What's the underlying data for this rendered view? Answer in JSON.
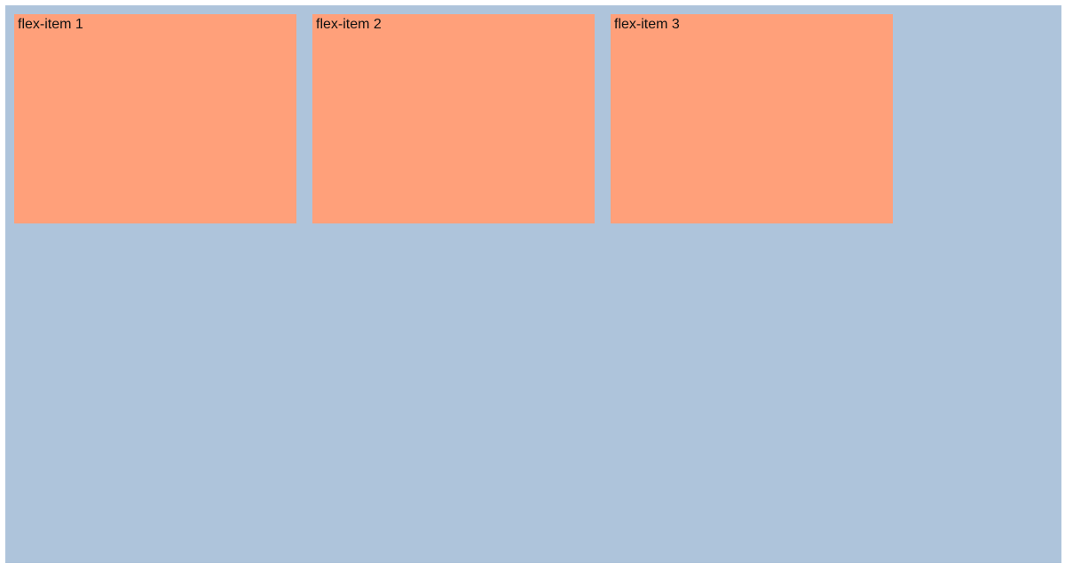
{
  "items": [
    {
      "label": "flex-item 1"
    },
    {
      "label": "flex-item 2"
    },
    {
      "label": "flex-item 3"
    }
  ],
  "colors": {
    "containerBg": "#aec4db",
    "itemBg": "#ffa07a"
  }
}
